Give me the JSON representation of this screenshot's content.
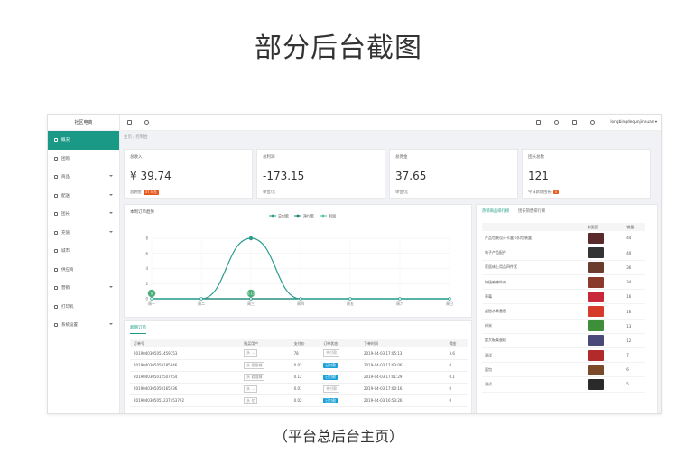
{
  "page_title": "部分后台截图",
  "caption": "（平台总后台主页）",
  "sidebar": {
    "brand": "社区电商",
    "items": [
      {
        "label": "概况",
        "active": true,
        "arrow": false,
        "icon": "home-icon"
      },
      {
        "label": "团购",
        "active": false,
        "arrow": false,
        "icon": "group-icon"
      },
      {
        "label": "商品",
        "active": false,
        "arrow": true,
        "icon": "goods-icon"
      },
      {
        "label": "配送",
        "active": false,
        "arrow": true,
        "icon": "delivery-icon"
      },
      {
        "label": "团长",
        "active": false,
        "arrow": true,
        "icon": "leader-icon"
      },
      {
        "label": "充值",
        "active": false,
        "arrow": true,
        "icon": "recharge-icon"
      },
      {
        "label": "城市",
        "active": false,
        "arrow": false,
        "icon": "city-icon"
      },
      {
        "label": "供应商",
        "active": false,
        "arrow": false,
        "icon": "supplier-icon"
      },
      {
        "label": "营销",
        "active": false,
        "arrow": true,
        "icon": "marketing-icon"
      },
      {
        "label": "打印机",
        "active": false,
        "arrow": false,
        "icon": "printer-icon"
      },
      {
        "label": "系统设置",
        "active": false,
        "arrow": true,
        "icon": "settings-icon"
      }
    ]
  },
  "topbar": {
    "user": "longbingdequnjinhuan ▾"
  },
  "breadcrumb": "主页 / 控制台",
  "stats": [
    {
      "title": "总收入",
      "value": "¥ 39.74",
      "sub": "总佣金",
      "badge": "37.5 元"
    },
    {
      "title": "总利润",
      "value": "-173.15",
      "sub": "单位/元",
      "badge": ""
    },
    {
      "title": "总佣金",
      "value": "37.65",
      "sub": "单位/元",
      "badge": ""
    },
    {
      "title": "团长总数",
      "value": "121",
      "sub": "今日新增团长",
      "badge": "0"
    }
  ],
  "chart_data": {
    "type": "line",
    "title": "本周订单趋势",
    "categories": [
      "周一",
      "周二",
      "周三",
      "周四",
      "周五",
      "周六",
      "周日"
    ],
    "ylim": [
      0,
      8
    ],
    "yticks": [
      0,
      2,
      4,
      6,
      8
    ],
    "legend_position": "top-center",
    "series": [
      {
        "name": "总付款",
        "color": "#2a9d8f",
        "values": [
          0,
          0,
          8,
          0,
          0,
          0,
          0
        ]
      },
      {
        "name": "净付款",
        "color": "#1b7f73",
        "values": [
          0,
          0,
          0,
          0,
          0,
          0,
          0
        ]
      },
      {
        "name": "利润",
        "color": "#59c3a6",
        "values": [
          0,
          0,
          0,
          0,
          0,
          0,
          0
        ]
      }
    ],
    "point_labels": [
      {
        "index": 0,
        "text": "0"
      },
      {
        "index": 2,
        "text": "0.13"
      }
    ]
  },
  "orders": {
    "tab": "新增订单",
    "columns": [
      "订单号",
      "购买用户",
      "支付价",
      "订单状态",
      "下单时间",
      "佣金"
    ],
    "rows": [
      {
        "id": "2019040305051459753",
        "buyer": "头 ...",
        "price": "78",
        "status": "待付款",
        "status_type": "wait",
        "time": "2019-04-03 17:05:13",
        "commission": "3.6"
      },
      {
        "id": "2019040305050185946",
        "buyer": "头 君临城",
        "price": "0.02",
        "status": "已付款",
        "status_type": "pay",
        "time": "2019-04-03 17:03:06",
        "commission": "0"
      },
      {
        "id": "2019040305012507954",
        "buyer": "头 君临城",
        "price": "0.12",
        "status": "已付款",
        "status_type": "pay",
        "time": "2019-04-03 17:01:29",
        "commission": "0.1"
      },
      {
        "id": "2019040305050165936",
        "buyer": "头 ...",
        "price": "0.01",
        "status": "待付款",
        "status_type": "wait",
        "time": "2019-04-03 17:00:16",
        "commission": "0"
      },
      {
        "id": "2019040305051237453792",
        "buyer": "头 亿",
        "price": "0.02",
        "status": "已付款",
        "status_type": "pay",
        "time": "2019-04-03 16:53:26",
        "commission": "0"
      }
    ]
  },
  "ranking": {
    "tabs": [
      "热销商品排行榜",
      "团长销售排行榜"
    ],
    "columns": [
      "",
      "封面图",
      "销量"
    ],
    "rows": [
      {
        "name": "产品包装设计卡盒卡扣包装盒",
        "color": "#5a2a2a",
        "sales": "44"
      },
      {
        "name": "电子产品配件",
        "color": "#333333",
        "sales": "40"
      },
      {
        "name": "家居床上用品四件套",
        "color": "#6b3b2e",
        "sales": "36"
      },
      {
        "name": "特级麻辣牛肉",
        "color": "#8a3a2a",
        "sales": "34"
      },
      {
        "name": "草莓",
        "color": "#c8283a",
        "sales": "16"
      },
      {
        "name": "超甜水果番茄",
        "color": "#d63a2a",
        "sales": "16"
      },
      {
        "name": "绿米",
        "color": "#3e8f3a",
        "sales": "13"
      },
      {
        "name": "超大板栗蛋糕",
        "color": "#4a4a7a",
        "sales": "12"
      },
      {
        "name": "测试",
        "color": "#b22a2a",
        "sales": "7"
      },
      {
        "name": "面包",
        "color": "#7a4a2a",
        "sales": "6"
      },
      {
        "name": "测试",
        "color": "#2a2a2a",
        "sales": "5"
      }
    ]
  }
}
